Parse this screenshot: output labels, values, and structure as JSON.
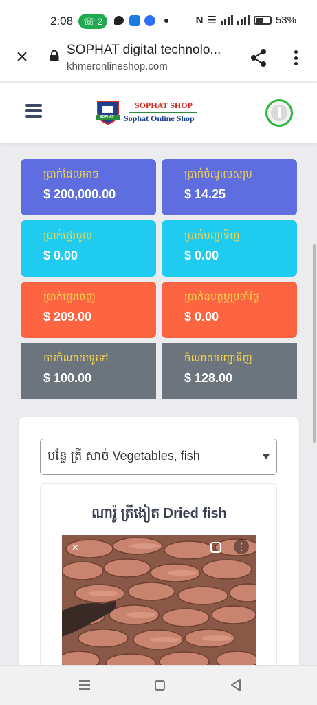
{
  "status_bar": {
    "time": "2:08",
    "notification_count": "2",
    "battery": "53%",
    "accent": "#1faa4f"
  },
  "browser": {
    "title": "SOPHAT digital technolo...",
    "url": "khmeronlineshop.com",
    "icons": [
      "close-icon",
      "lock-icon",
      "share-icon",
      "more-vert-icon"
    ]
  },
  "header": {
    "logo_top": "SOPHAT SHOP",
    "logo_bottom": "Sophat Online Shop",
    "logo_badge": "SOPHAT",
    "brand_red": "#d7261e",
    "brand_blue": "#1d3f8f"
  },
  "stats": [
    {
      "label": "ប្រាក់ដែលអាច",
      "value": "$ 200,000.00",
      "color": "#5e6ee0"
    },
    {
      "label": "ប្រាក់ចំណូលសរុប",
      "value": "$ 14.25",
      "color": "#5e6ee0"
    },
    {
      "label": "ប្រាក់ផ្ទេរចូល",
      "value": "$ 0.00",
      "color": "#1fcbef"
    },
    {
      "label": "ប្រាក់បញ្ជាទិញ",
      "value": "$ 0.00",
      "color": "#1fcbef"
    },
    {
      "label": "ប្រាក់ផ្ទេរចេញ",
      "value": "$ 209.00",
      "color": "#fd6442"
    },
    {
      "label": "ប្រាក់ឧបត្ថម្ភប្រចាំថ្ងៃ",
      "value": "$ 0.00",
      "color": "#fd6442"
    },
    {
      "label": "ការចំណាយទូទៅ",
      "value": "$ 100.00",
      "color": "#6c757d"
    },
    {
      "label": "ចំណាយបញ្ជាទិញ",
      "value": "$ 128.00",
      "color": "#6c757d"
    }
  ],
  "category_select": {
    "selected": "បន្លែ ត្រី សាច់ Vegetables, fish"
  },
  "product": {
    "title": "ណារ៉ូ ត្រីងៀត Dried fish"
  }
}
